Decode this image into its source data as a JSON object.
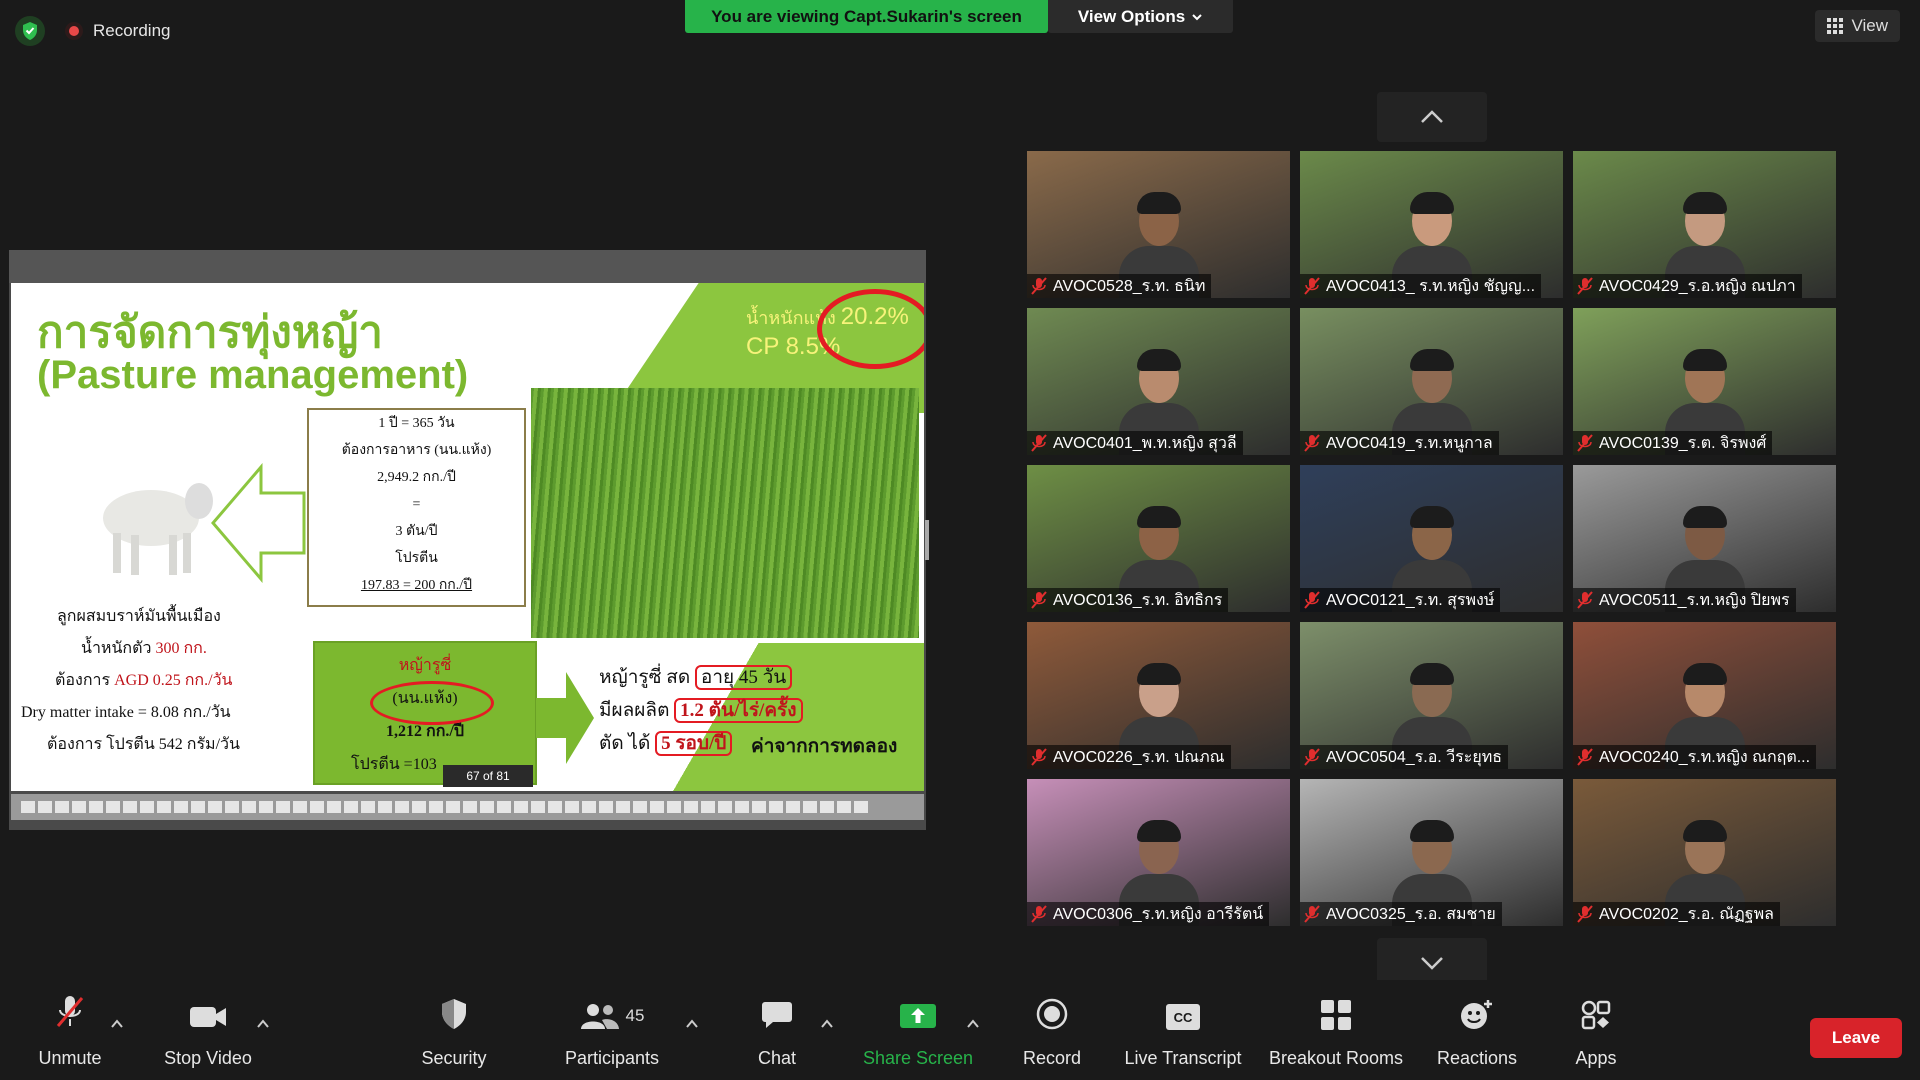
{
  "top_bar": {
    "recording_label": "Recording",
    "viewing_banner": "You are viewing Capt.Sukarin's screen",
    "view_options_label": "View Options",
    "view_label": "View"
  },
  "slide": {
    "title_th": "การจัดการทุ่งหญ้า",
    "title_en": "(Pasture management)",
    "stat_dry_label": "น้ำหนักแห้ง",
    "stat_dry_value": "20.2%",
    "stat_cp": "CP 8.5%",
    "box_lines": [
      "1 ปี = 365 วัน",
      "ต้องการอาหาร (นน.แห้ง)",
      "2,949.2 กก./ปี",
      "=",
      "3 ตัน/ปี",
      "โปรตีน",
      "197.83 = 200 กก./ปี"
    ],
    "cow_caption": "ลูกผสมบราห์มันพื้นเมือง",
    "weight_label": "น้ำหนักตัว",
    "weight_value": "300 กก.",
    "agd_label": "ต้องการ",
    "agd_value": "AGD 0.25 กก./วัน",
    "dmi": "Dry matter intake = 8.08 กก./วัน",
    "protein_need": "ต้องการ โปรตีน 542 กรัม/วัน",
    "green_l1": "หญ้ารูซี่",
    "green_l2": "(นน.แห้ง)",
    "green_l3": "1,212 กก./ปี",
    "green_l4": "โปรตีน =103",
    "page_indicator": "67 of 81",
    "right_l1_a": "หญ้ารูซี่ สด",
    "right_l1_b": "อายุ 45 วัน",
    "right_l2_a": "มีผลผลิต",
    "right_l2_b": "1.2 ตัน/ไร่/ครั้ง",
    "right_l3_a": "ตัด ได้",
    "right_l3_b": "5 รอบ/ปี",
    "experiment_note": "ค่าจากการทดลอง"
  },
  "participants_gallery": [
    {
      "name": "AVOC0528_ร.ท. ธนิท",
      "bg": "#8a6a4a",
      "skin": "#8b6347"
    },
    {
      "name": "AVOC0413_ ร.ท.หญิง ชัญญ...",
      "bg": "#6b8a4a",
      "skin": "#c99a7d"
    },
    {
      "name": "AVOC0429_ร.อ.หญิง ณปภา",
      "bg": "#6b8a4a",
      "skin": "#c49a80"
    },
    {
      "name": "AVOC0401_พ.ท.หญิง สุวลี",
      "bg": "#6f8a52",
      "skin": "#b98b6e"
    },
    {
      "name": "AVOC0419_ร.ท.หนูกาล",
      "bg": "#788f60",
      "skin": "#8f6a52"
    },
    {
      "name": "AVOC0139_ร.ต. จิรพงศ์",
      "bg": "#7fa05a",
      "skin": "#a07556"
    },
    {
      "name": "AVOC0136_ร.ท. อิทธิกร",
      "bg": "#6e8f45",
      "skin": "#8d6246"
    },
    {
      "name": "AVOC0121_ร.ท. สุรพงษ์",
      "bg": "#2f3f5a",
      "skin": "#8b6548"
    },
    {
      "name": "AVOC0511_ร.ท.หญิง ปิยพร",
      "bg": "#9a9a9a",
      "skin": "#7d5a44"
    },
    {
      "name": "AVOC0226_ร.ท. ปณภณ",
      "bg": "#8f5a3a",
      "skin": "#c9a08a"
    },
    {
      "name": "AVOC0504_ร.อ. วีระยุทธ",
      "bg": "#7d8f6a",
      "skin": "#8a6a52"
    },
    {
      "name": "AVOC0240_ร.ท.หญิง ณกฤต...",
      "bg": "#8f4f3a",
      "skin": "#b7896a"
    },
    {
      "name": "AVOC0306_ร.ท.หญิง อารีรัตน์",
      "bg": "#c68fb8",
      "skin": "#8a6450"
    },
    {
      "name": "AVOC0325_ร.อ. สมชาย",
      "bg": "#b5b5b5",
      "skin": "#8b684f"
    },
    {
      "name": "AVOC0202_ร.อ. ณัฏฐพล",
      "bg": "#7a5a3a",
      "skin": "#9a7458"
    }
  ],
  "toolbar": {
    "unmute": "Unmute",
    "stop_video": "Stop Video",
    "security": "Security",
    "participants": "Participants",
    "participants_count": "45",
    "chat": "Chat",
    "share_screen": "Share Screen",
    "record": "Record",
    "live_transcript": "Live Transcript",
    "breakout_rooms": "Breakout Rooms",
    "reactions": "Reactions",
    "apps": "Apps",
    "leave": "Leave",
    "cc_icon_text": "CC"
  },
  "colors": {
    "share_green": "#27b34a",
    "leave_red": "#d8232a",
    "slide_green": "#7cb82f"
  }
}
